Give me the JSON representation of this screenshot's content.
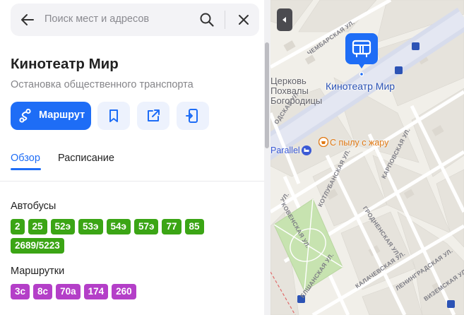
{
  "search": {
    "placeholder": "Поиск мест и адресов"
  },
  "place": {
    "title": "Кинотеатр Мир",
    "subtitle": "Остановка общественного транспорта"
  },
  "actions": {
    "route_label": "Маршрут"
  },
  "tabs": [
    {
      "label": "Обзор",
      "active": true
    },
    {
      "label": "Расписание",
      "active": false
    }
  ],
  "transport": {
    "buses_label": "Автобусы",
    "buses": [
      "2",
      "25",
      "52э",
      "53э",
      "54э",
      "57э",
      "77",
      "85",
      "2689/5223"
    ],
    "minibuses_label": "Маршрутки",
    "minibuses": [
      "3с",
      "8с",
      "70а",
      "174",
      "260"
    ],
    "bus_color": "#3ba515",
    "minibus_color": "#b43fc8"
  },
  "map": {
    "stop_label": "Кинотеатр Мир",
    "church_label": "Церковь Похвалы Богородицы",
    "parallel_label": "Parallel",
    "cafe_label": "С пылу с жару",
    "streets": [
      "ЧЕМБАРСКАЯ УЛ.",
      "КОТЛУБАНСКАЯ УЛ.",
      "КАРПОВСКАЯ УЛ.",
      "ГРОДНЕНСКАЯ УЛ.",
      "ЛЕНИНГРАДСКАЯ УЛ.",
      "КАЛАЧЕВСКАЯ УЛ.",
      "ЕЛШАНСКАЯ УЛ.",
      "КОВЕНСКАЯ УЛ.",
      "ВИЗЕМСКАЯ УЛ.",
      "УЛ.",
      "ОДСКАЯ УЛ."
    ],
    "accent": "#1e6df6"
  }
}
